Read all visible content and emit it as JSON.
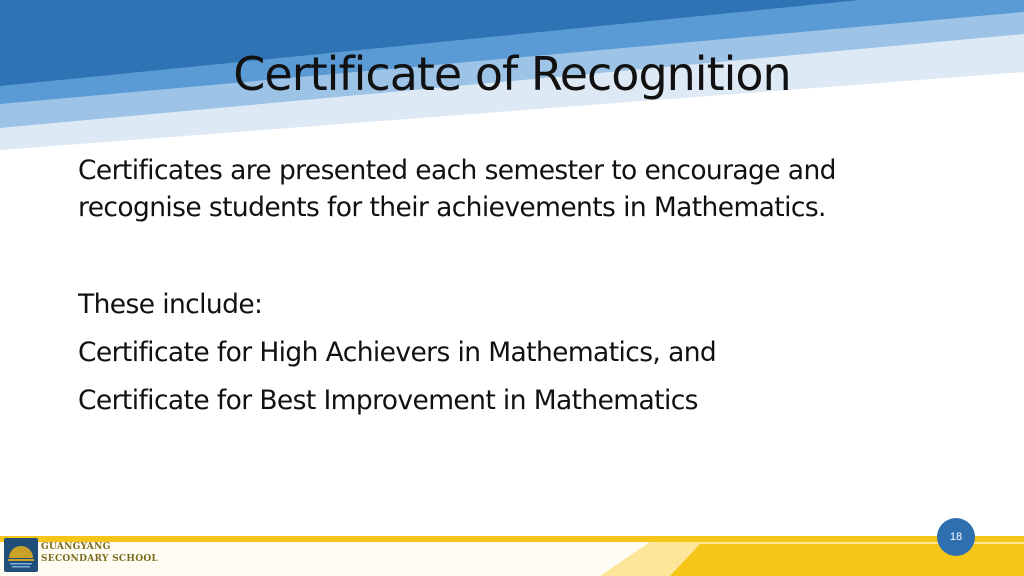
{
  "slide": {
    "title": "Certificate of Recognition",
    "intro_line_1": "Certificates are presented each semester to encourage and",
    "intro_line_2": "recognise students for their achievements in Mathematics.",
    "list_heading": "These include:",
    "items": [
      "Certificate for High Achievers in Mathematics, and",
      "Certificate for Best Improvement in Mathematics"
    ],
    "page_number": "18"
  },
  "footer": {
    "school_name_line_1": "GUANGYANG",
    "school_name_line_2": "SECONDARY SCHOOL"
  },
  "colors": {
    "banner_dark_blue": "#2e74b5",
    "banner_light_blue": "#9dc3e6",
    "footer_gold": "#f5c518",
    "footer_light_gold": "#fde59a",
    "badge_blue": "#2e6fb0"
  }
}
